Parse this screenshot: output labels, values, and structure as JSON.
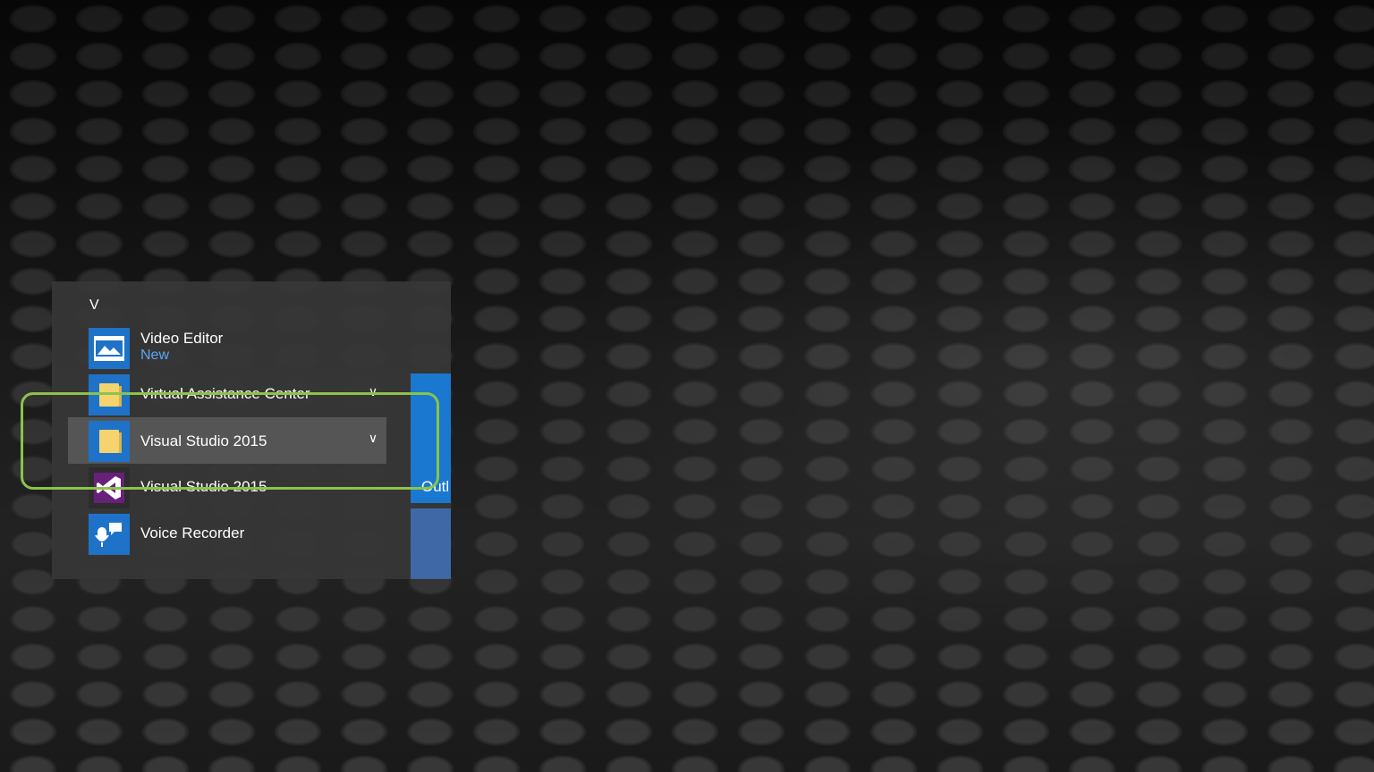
{
  "start_menu": {
    "section_letter": "V",
    "apps": [
      {
        "label": "Video Editor",
        "sublabel": "New",
        "icon": "video-editor-icon",
        "expandable": false
      },
      {
        "label": "Virtual Assistance Center",
        "icon": "folder-icon",
        "expandable": true
      },
      {
        "label": "Visual Studio 2015",
        "icon": "folder-icon",
        "expandable": true,
        "hovered": true
      },
      {
        "label": "Visual Studio 2015",
        "icon": "visual-studio-icon",
        "expandable": false
      },
      {
        "label": "Voice Recorder",
        "icon": "voice-recorder-icon",
        "expandable": false
      }
    ]
  },
  "tiles": {
    "partial_tile_text": "Outl"
  },
  "colors": {
    "highlight": "#8bc34a",
    "new_badge": "#5ba8f5",
    "tile_blue": "#1a78d0"
  }
}
